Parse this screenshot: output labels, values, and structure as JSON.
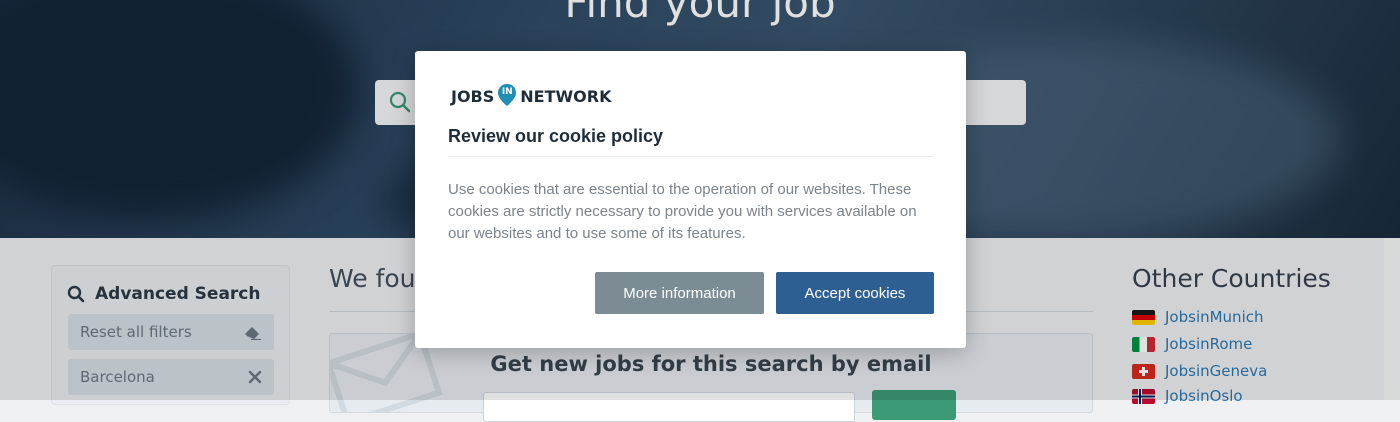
{
  "hero": {
    "title": "Find your job",
    "search_icon": "search-icon"
  },
  "sidebar": {
    "title": "Advanced Search",
    "title_icon": "search-icon",
    "reset_label": "Reset all filters",
    "reset_icon": "eraser-icon",
    "filters": [
      {
        "label": "Barcelona",
        "icon": "close-icon"
      }
    ]
  },
  "results": {
    "title": "We fou",
    "email_alert": {
      "title": "Get new jobs for this search by email",
      "icon": "envelope-icon"
    }
  },
  "other_countries": {
    "title": "Other Countries",
    "items": [
      {
        "label": "JobsinMunich",
        "flag": "germany-flag-icon"
      },
      {
        "label": "JobsinRome",
        "flag": "italy-flag-icon"
      },
      {
        "label": "JobsinGeneva",
        "flag": "switzerland-flag-icon"
      },
      {
        "label": "JobsinOslo",
        "flag": "norway-flag-icon"
      }
    ]
  },
  "cookie_modal": {
    "brand": {
      "jobs": "JOBS",
      "in": "IN",
      "network": "NETWORK"
    },
    "title": "Review our cookie policy",
    "body": "Use cookies that are essential to the operation of our websites. These cookies are strictly necessary to provide you with services available on our websites and to use some of its features.",
    "more_label": "More information",
    "accept_label": "Accept cookies"
  },
  "colors": {
    "accent_blue": "#2e5f93",
    "secondary_gray": "#7b8c95",
    "link_blue": "#2e78b3",
    "brand_teal": "#1f8fb6"
  }
}
